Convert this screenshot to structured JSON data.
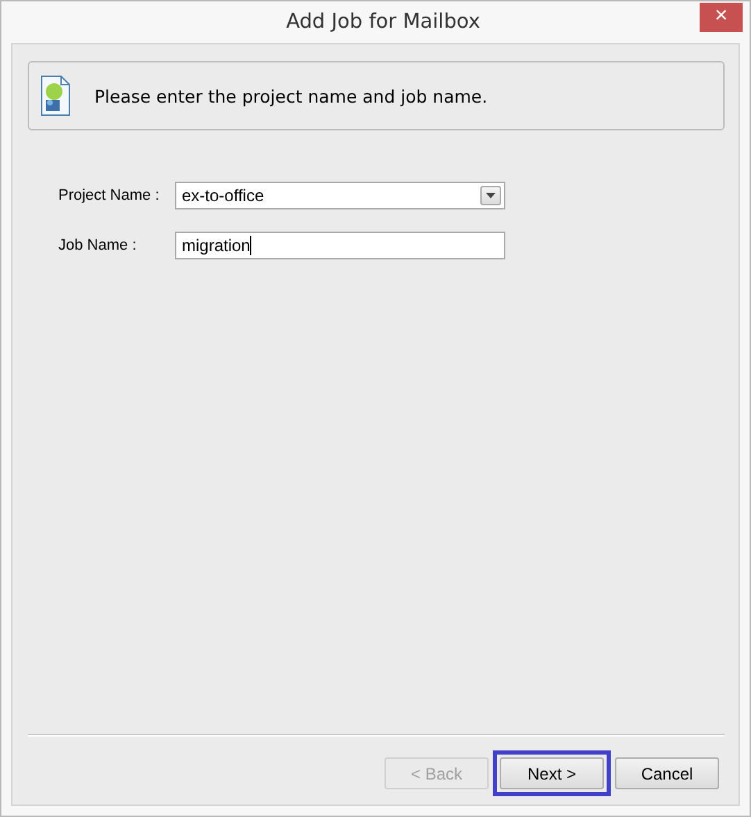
{
  "window": {
    "title": "Add Job for Mailbox",
    "close": "×"
  },
  "header": {
    "message": "Please enter the project name and job name."
  },
  "fields": [
    {
      "kind": "dropdown",
      "label": "Project Name :",
      "value": "ex-to-office"
    },
    {
      "kind": "text",
      "label": "Job Name :",
      "value": "migration",
      "focused": true
    }
  ],
  "buttons": [
    {
      "label": "< Back",
      "disabled": true,
      "focused": false
    },
    {
      "label": "Next >",
      "disabled": false,
      "focused": true
    },
    {
      "label": "Cancel",
      "disabled": false,
      "focused": false
    }
  ]
}
